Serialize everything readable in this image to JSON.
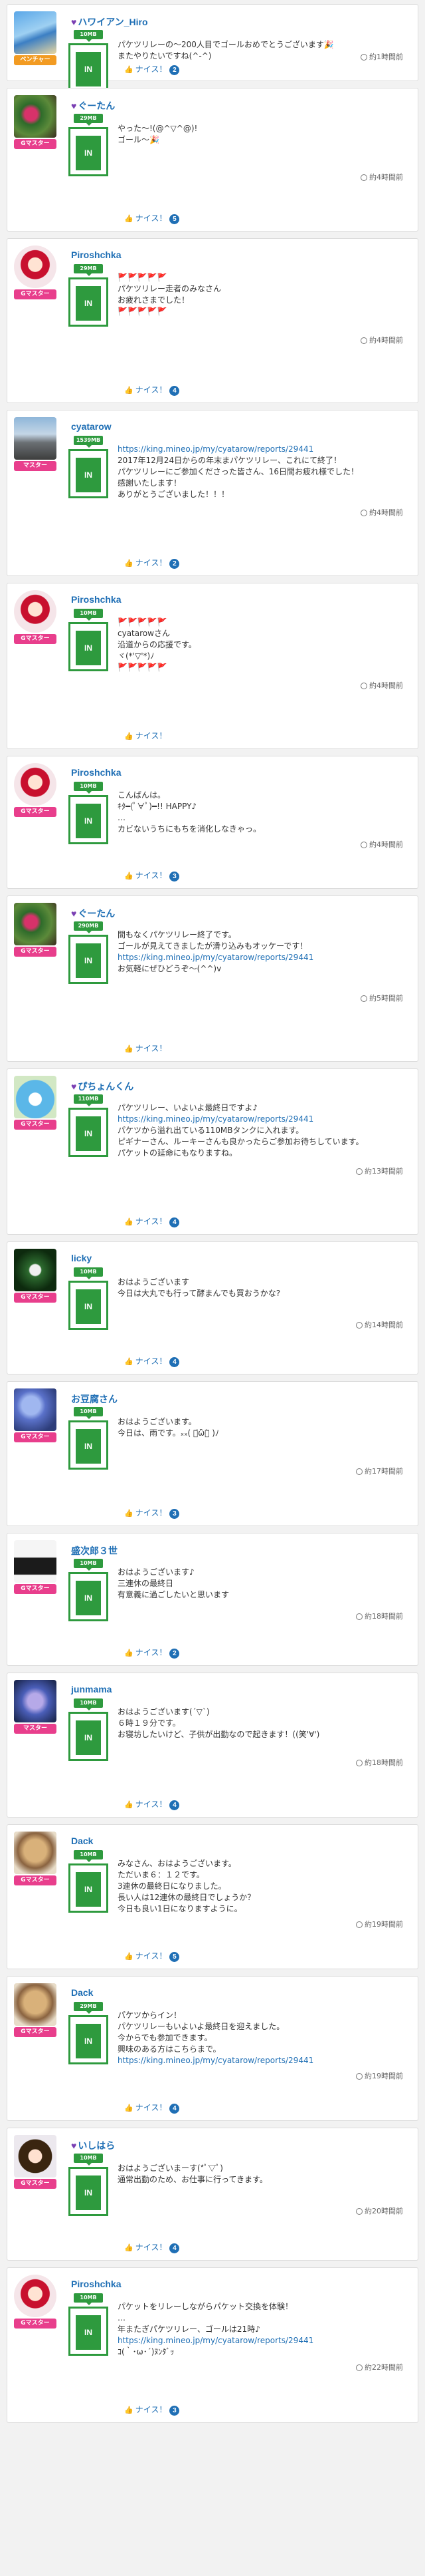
{
  "ui": {
    "nice_label": "ナイス！"
  },
  "posts": [
    {
      "name": "ハワイアン_Hiro",
      "heart": true,
      "badge": "ベンチャー",
      "badge_color": "orange",
      "mb": "10MB",
      "lines": [
        "パケツリレーの〜200人目でゴールおめでとうございます🎉",
        "またやりたいですね(^-^)"
      ],
      "link": "",
      "after_link": [],
      "time": "約1時間前",
      "likes": "2",
      "avatar": "surf"
    },
    {
      "name": "ぐーたん",
      "heart": true,
      "badge": "Gマスター",
      "badge_color": "pink",
      "mb": "29MB",
      "lines": [
        "やった〜!(@^▽^@)!",
        "ゴール〜🎉"
      ],
      "link": "",
      "after_link": [],
      "time": "約4時間前",
      "likes": "5",
      "avatar": "flower"
    },
    {
      "name": "Piroshchka",
      "heart": false,
      "badge": "Gマスター",
      "badge_color": "pink",
      "mb": "29MB",
      "lines": [
        "🚩🚩🚩🚩🚩",
        "パケツリレー走者のみなさん",
        "お疲れさまでした！",
        "🚩🚩🚩🚩🚩"
      ],
      "link": "",
      "after_link": [],
      "time": "約4時間前",
      "likes": "4",
      "avatar": "doll"
    },
    {
      "name": "cyatarow",
      "heart": false,
      "badge": "マスター",
      "badge_color": "pink",
      "mb": "1539MB",
      "lines": [],
      "link": "https://king.mineo.jp/my/cyatarow/reports/29441",
      "after_link": [
        "2017年12月24日からの年末まパケツリレー、これにて終了！",
        "パケツリレーにご参加くださった皆さん、16日間お疲れ様でした！",
        "感謝いたします！",
        "ありがとうございました！！！"
      ],
      "time": "約4時間前",
      "likes": "2",
      "avatar": "mountain"
    },
    {
      "name": "Piroshchka",
      "heart": false,
      "badge": "Gマスター",
      "badge_color": "pink",
      "mb": "10MB",
      "lines": [
        "🚩🚩🚩🚩🚩",
        "cyatarowさん",
        "沿道からの応援です。",
        "ヾ(*'▽'*)ﾉ",
        "🚩🚩🚩🚩🚩"
      ],
      "link": "",
      "after_link": [],
      "time": "約4時間前",
      "likes": "",
      "avatar": "doll"
    },
    {
      "name": "Piroshchka",
      "heart": false,
      "badge": "Gマスター",
      "badge_color": "pink",
      "mb": "10MB",
      "lines": [
        "こんばんは。",
        "ｷﾀ━(ﾟ∀ﾟ)━!! HAPPY♪",
        "…",
        "カビないうちにもちを消化しなきゃっ。"
      ],
      "link": "",
      "after_link": [],
      "time": "約4時間前",
      "likes": "3",
      "avatar": "doll"
    },
    {
      "name": "ぐーたん",
      "heart": true,
      "badge": "Gマスター",
      "badge_color": "pink",
      "mb": "290MB",
      "lines": [
        "間もなくパケツリレー終了です。",
        "ゴールが見えてきましたが滑り込みもオッケーです！"
      ],
      "link": "https://king.mineo.jp/my/cyatarow/reports/29441",
      "after_link": [
        "お気軽にぜひどうぞ〜(^^)v"
      ],
      "time": "約5時間前",
      "likes": "",
      "avatar": "flower"
    },
    {
      "name": "ぴちょんくん",
      "heart": true,
      "badge": "Gマスター",
      "badge_color": "pink",
      "mb": "110MB",
      "lines": [
        "パケツリレー、いよいよ最終日ですよ♪"
      ],
      "link": "https://king.mineo.jp/my/cyatarow/reports/29441",
      "after_link": [
        "パケツから溢れ出ている110MBタンクに入れます。",
        "ピギナーさん、ルーキーさんも良かったらご参加お待ちしています。",
        "パケットの延命にもなりますね。"
      ],
      "time": "約13時間前",
      "likes": "4",
      "avatar": "blue"
    },
    {
      "name": "licky",
      "heart": false,
      "badge": "Gマスター",
      "badge_color": "pink",
      "mb": "10MB",
      "lines": [
        "おはようございます",
        "今日は大丸でも行って酵まんでも買おうかな?"
      ],
      "link": "",
      "after_link": [],
      "time": "約14時間前",
      "likes": "4",
      "avatar": "dark"
    },
    {
      "name": "お豆腐さん",
      "heart": false,
      "badge": "Gマスター",
      "badge_color": "pink",
      "mb": "10MB",
      "lines": [
        "おはようございます。",
        "今日は、雨です。ₓₓ( ･᷄ὢ･᷅ )ﾉ"
      ],
      "link": "",
      "after_link": [],
      "time": "約17時間前",
      "likes": "3",
      "avatar": "hydrangea"
    },
    {
      "name": "盛次郎３世",
      "heart": false,
      "badge": "Gマスター",
      "badge_color": "pink",
      "mb": "10MB",
      "lines": [
        "おはようございます♪",
        "三連休の最終日",
        "有意義に過ごしたいと思います"
      ],
      "link": "",
      "after_link": [],
      "time": "約18時間前",
      "likes": "2",
      "avatar": "ninja"
    },
    {
      "name": "junmama",
      "heart": false,
      "badge": "マスター",
      "badge_color": "pink",
      "mb": "10MB",
      "lines": [
        "おはようございます(´▽`)",
        "６時１９分です。",
        "お寝坊したいけど、子供が出勤なので起きます！((笑'∀')"
      ],
      "link": "",
      "after_link": [],
      "time": "約18時間前",
      "likes": "4",
      "avatar": "hydrangea2"
    },
    {
      "name": "Dack",
      "heart": false,
      "badge": "Gマスター",
      "badge_color": "pink",
      "mb": "10MB",
      "lines": [
        "みなさん、おはようございます。",
        "ただいま６：１２です。",
        "3連休の最終日になりました。",
        "長い人は12連休の最終日でしょうか？",
        "今日も良い1日になりますように。"
      ],
      "link": "",
      "after_link": [],
      "time": "約19時間前",
      "likes": "5",
      "avatar": "bear"
    },
    {
      "name": "Dack",
      "heart": false,
      "badge": "Gマスター",
      "badge_color": "pink",
      "mb": "29MB",
      "lines": [
        "パケツからイン！",
        "パケツリレーもいよいよ最終日を迎えました。",
        "今からでも参加できます。",
        "興味のある方はこちらまで。"
      ],
      "link": "https://king.mineo.jp/my/cyatarow/reports/29441",
      "after_link": [],
      "time": "約19時間前",
      "likes": "4",
      "avatar": "bear"
    },
    {
      "name": "いしはら",
      "heart": true,
      "badge": "Gマスター",
      "badge_color": "pink",
      "mb": "10MB",
      "lines": [
        "おはようございまーす(*ﾟ▽ﾟ)",
        "通常出勤のため、お仕事に行ってきます。"
      ],
      "link": "",
      "after_link": [],
      "time": "約20時間前",
      "likes": "4",
      "avatar": "anime"
    },
    {
      "name": "Piroshchka",
      "heart": false,
      "badge": "Gマスター",
      "badge_color": "pink",
      "mb": "10MB",
      "lines": [
        "パケットをリレーしながらパケット交換を体験！",
        "…",
        "年またぎパケツリレー、ゴールは21時♪"
      ],
      "link": "https://king.mineo.jp/my/cyatarow/reports/29441",
      "after_link": [
        "ｺ(｀･ω･´)ﾇﾝﾀﾞｯ"
      ],
      "time": "約22時間前",
      "likes": "3",
      "avatar": "doll"
    }
  ]
}
